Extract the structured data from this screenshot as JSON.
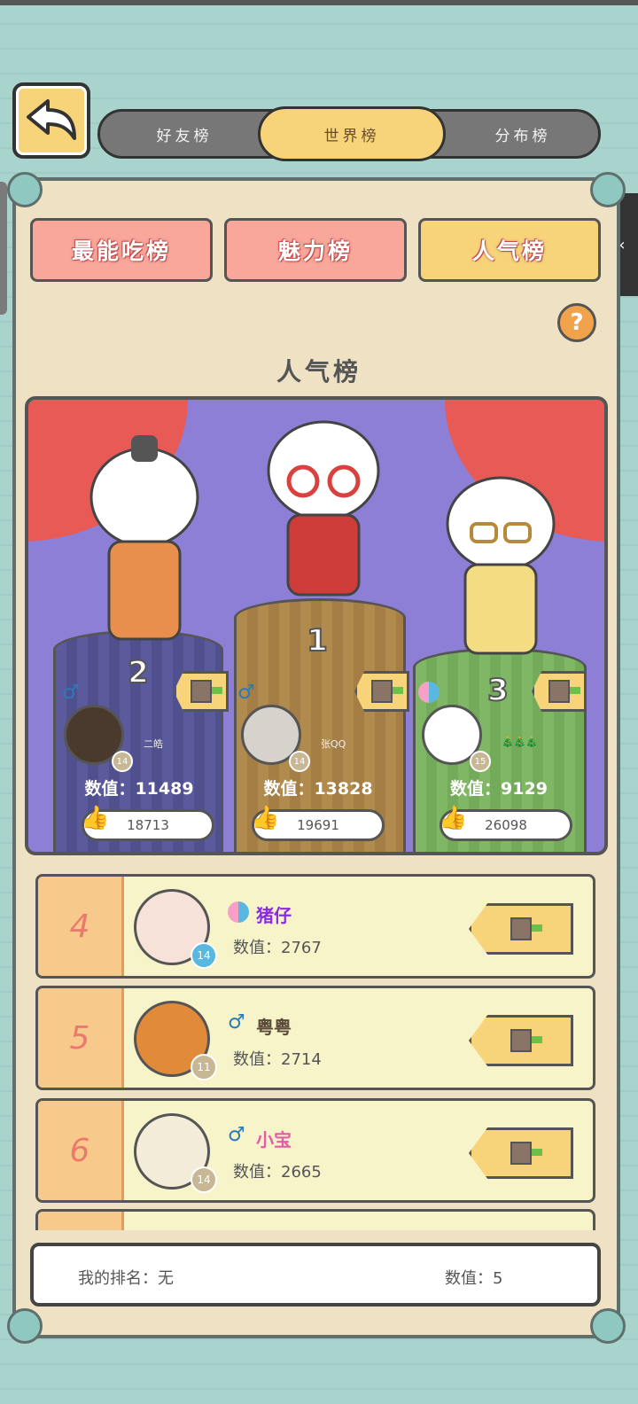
{
  "top_tabs": [
    {
      "label": "好友榜",
      "active": false
    },
    {
      "label": "世界榜",
      "active": true
    },
    {
      "label": "分布榜",
      "active": false
    }
  ],
  "sub_tabs": [
    {
      "label": "最能吃榜",
      "active": false
    },
    {
      "label": "魅力榜",
      "active": false
    },
    {
      "label": "人气榜",
      "active": true
    }
  ],
  "help_label": "?",
  "board_title": "人气榜",
  "podium": [
    {
      "rank": "2",
      "name": "二皓",
      "value_text": "数值：11489",
      "likes": "18713",
      "level": "14"
    },
    {
      "rank": "1",
      "name": "张QQ",
      "value_text": "数值：13828",
      "likes": "19691",
      "level": "14"
    },
    {
      "rank": "3",
      "name": "🎄🎄🎄",
      "value_text": "数值：9129",
      "likes": "26098",
      "level": "15"
    }
  ],
  "list": [
    {
      "rank": "4",
      "name": "猪仔",
      "value_text": "数值：2767",
      "level": "14",
      "name_color": "#8a2be2",
      "gender_icon": "yin-yang-icon"
    },
    {
      "rank": "5",
      "name": "粤粤",
      "value_text": "数值：2714",
      "level": "11",
      "name_color": "#5a4a3a",
      "gender_icon": "male-icon"
    },
    {
      "rank": "6",
      "name": "小宝",
      "value_text": "数值：2665",
      "level": "14",
      "name_color": "#e65aa8",
      "gender_icon": "male-icon"
    }
  ],
  "my_rank": {
    "rank_text": "我的排名：无",
    "value_text": "数值：5"
  },
  "colors": {
    "accent": "#f7d37a",
    "tab_inactive": "#f8a79a",
    "stage": "#8d7fd6"
  }
}
